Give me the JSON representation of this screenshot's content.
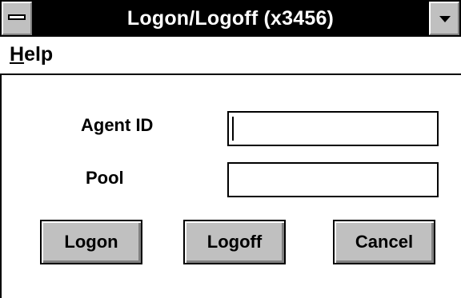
{
  "window": {
    "title": "Logon/Logoff (x3456)"
  },
  "menu": {
    "help_mnemonic": "H",
    "help_rest": "elp"
  },
  "form": {
    "agent_id_label": "Agent ID",
    "agent_id_value": "",
    "pool_label": "Pool",
    "pool_value": ""
  },
  "buttons": {
    "logon": "Logon",
    "logoff": "Logoff",
    "cancel": "Cancel"
  }
}
